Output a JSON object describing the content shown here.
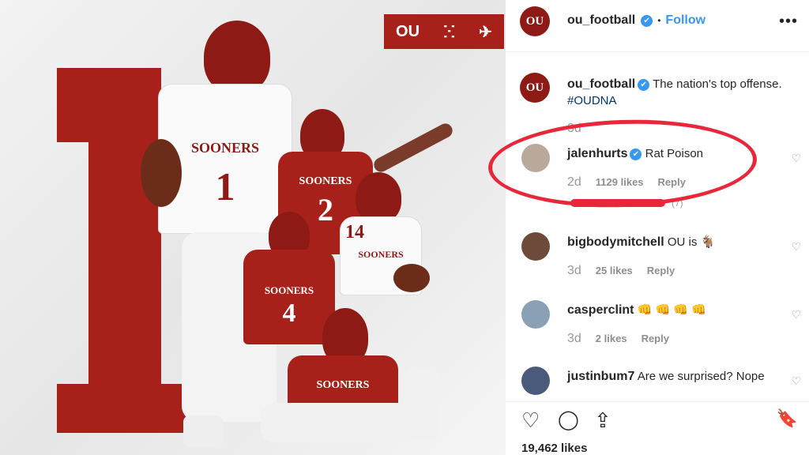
{
  "post": {
    "image_text": {
      "brand_ou": "OU",
      "brand_dna": "ⵘ",
      "brand_jordan": "✈",
      "players": [
        {
          "word": "SOONERS",
          "number": "1"
        },
        {
          "word": "SOONERS",
          "number": "2"
        },
        {
          "word": "SOONERS",
          "number": "14"
        },
        {
          "word": "SOONERS",
          "number": "4"
        },
        {
          "word": "SOONERS",
          "number": ""
        }
      ]
    }
  },
  "header": {
    "avatar_text": "OU",
    "username": "ou_football",
    "verified_icon": "✔",
    "separator": "•",
    "follow_label": "Follow",
    "more_icon": "•••"
  },
  "caption": {
    "username": "ou_football",
    "text": "The nation's top offense.",
    "hashtag": "#OUDNA",
    "age": "3d"
  },
  "comments": [
    {
      "username": "jalenhurts",
      "verified": true,
      "text": "Rat Poison",
      "age": "2d",
      "likes": "1129 likes",
      "reply": "Reply",
      "avatar_color": "#b9a99a"
    },
    {
      "username": "bigbodymitchell",
      "verified": false,
      "text": "OU is 🐐",
      "age": "3d",
      "likes": "25 likes",
      "reply": "Reply",
      "avatar_color": "#6e4a3a"
    },
    {
      "username": "casperclint",
      "verified": false,
      "text": "👊 👊 👊 👊",
      "age": "3d",
      "likes": "2 likes",
      "reply": "Reply",
      "avatar_color": "#8aa1b5"
    },
    {
      "username": "justinbum7",
      "verified": false,
      "text": "Are we surprised? Nope",
      "age": "",
      "likes": "",
      "reply": "",
      "avatar_color": "#4a5a7a"
    }
  ],
  "hidden_replies_fragment": "(7)",
  "actions": {
    "like_icon": "♡",
    "comment_icon": "◯",
    "share_icon": "⇪",
    "save_icon": "🔖",
    "likes_count": "19,462 likes"
  },
  "colors": {
    "ou_crimson": "#a8201a",
    "ig_blue": "#3897f0",
    "highlight_red": "#e8283a"
  }
}
